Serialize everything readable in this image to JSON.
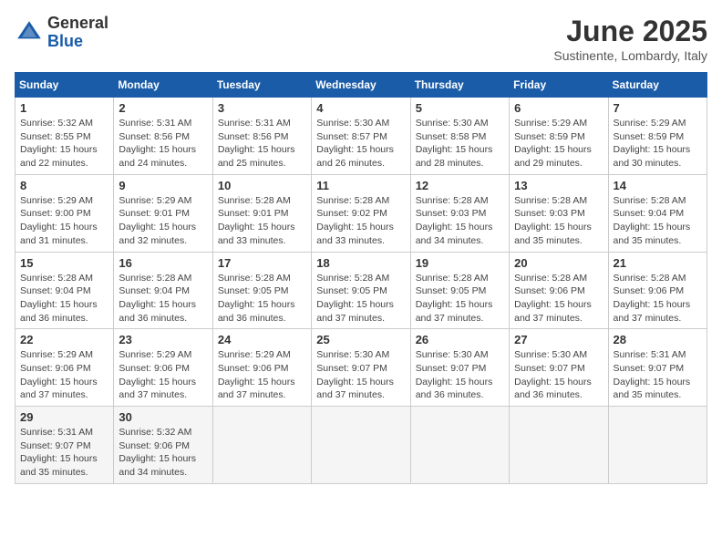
{
  "logo": {
    "general": "General",
    "blue": "Blue"
  },
  "header": {
    "month": "June 2025",
    "location": "Sustinente, Lombardy, Italy"
  },
  "weekdays": [
    "Sunday",
    "Monday",
    "Tuesday",
    "Wednesday",
    "Thursday",
    "Friday",
    "Saturday"
  ],
  "weeks": [
    [
      {
        "day": "1",
        "sunrise": "5:32 AM",
        "sunset": "8:55 PM",
        "daylight": "15 hours and 22 minutes."
      },
      {
        "day": "2",
        "sunrise": "5:31 AM",
        "sunset": "8:56 PM",
        "daylight": "15 hours and 24 minutes."
      },
      {
        "day": "3",
        "sunrise": "5:31 AM",
        "sunset": "8:56 PM",
        "daylight": "15 hours and 25 minutes."
      },
      {
        "day": "4",
        "sunrise": "5:30 AM",
        "sunset": "8:57 PM",
        "daylight": "15 hours and 26 minutes."
      },
      {
        "day": "5",
        "sunrise": "5:30 AM",
        "sunset": "8:58 PM",
        "daylight": "15 hours and 28 minutes."
      },
      {
        "day": "6",
        "sunrise": "5:29 AM",
        "sunset": "8:59 PM",
        "daylight": "15 hours and 29 minutes."
      },
      {
        "day": "7",
        "sunrise": "5:29 AM",
        "sunset": "8:59 PM",
        "daylight": "15 hours and 30 minutes."
      }
    ],
    [
      {
        "day": "8",
        "sunrise": "5:29 AM",
        "sunset": "9:00 PM",
        "daylight": "15 hours and 31 minutes."
      },
      {
        "day": "9",
        "sunrise": "5:29 AM",
        "sunset": "9:01 PM",
        "daylight": "15 hours and 32 minutes."
      },
      {
        "day": "10",
        "sunrise": "5:28 AM",
        "sunset": "9:01 PM",
        "daylight": "15 hours and 33 minutes."
      },
      {
        "day": "11",
        "sunrise": "5:28 AM",
        "sunset": "9:02 PM",
        "daylight": "15 hours and 33 minutes."
      },
      {
        "day": "12",
        "sunrise": "5:28 AM",
        "sunset": "9:03 PM",
        "daylight": "15 hours and 34 minutes."
      },
      {
        "day": "13",
        "sunrise": "5:28 AM",
        "sunset": "9:03 PM",
        "daylight": "15 hours and 35 minutes."
      },
      {
        "day": "14",
        "sunrise": "5:28 AM",
        "sunset": "9:04 PM",
        "daylight": "15 hours and 35 minutes."
      }
    ],
    [
      {
        "day": "15",
        "sunrise": "5:28 AM",
        "sunset": "9:04 PM",
        "daylight": "15 hours and 36 minutes."
      },
      {
        "day": "16",
        "sunrise": "5:28 AM",
        "sunset": "9:04 PM",
        "daylight": "15 hours and 36 minutes."
      },
      {
        "day": "17",
        "sunrise": "5:28 AM",
        "sunset": "9:05 PM",
        "daylight": "15 hours and 36 minutes."
      },
      {
        "day": "18",
        "sunrise": "5:28 AM",
        "sunset": "9:05 PM",
        "daylight": "15 hours and 37 minutes."
      },
      {
        "day": "19",
        "sunrise": "5:28 AM",
        "sunset": "9:05 PM",
        "daylight": "15 hours and 37 minutes."
      },
      {
        "day": "20",
        "sunrise": "5:28 AM",
        "sunset": "9:06 PM",
        "daylight": "15 hours and 37 minutes."
      },
      {
        "day": "21",
        "sunrise": "5:28 AM",
        "sunset": "9:06 PM",
        "daylight": "15 hours and 37 minutes."
      }
    ],
    [
      {
        "day": "22",
        "sunrise": "5:29 AM",
        "sunset": "9:06 PM",
        "daylight": "15 hours and 37 minutes."
      },
      {
        "day": "23",
        "sunrise": "5:29 AM",
        "sunset": "9:06 PM",
        "daylight": "15 hours and 37 minutes."
      },
      {
        "day": "24",
        "sunrise": "5:29 AM",
        "sunset": "9:06 PM",
        "daylight": "15 hours and 37 minutes."
      },
      {
        "day": "25",
        "sunrise": "5:30 AM",
        "sunset": "9:07 PM",
        "daylight": "15 hours and 37 minutes."
      },
      {
        "day": "26",
        "sunrise": "5:30 AM",
        "sunset": "9:07 PM",
        "daylight": "15 hours and 36 minutes."
      },
      {
        "day": "27",
        "sunrise": "5:30 AM",
        "sunset": "9:07 PM",
        "daylight": "15 hours and 36 minutes."
      },
      {
        "day": "28",
        "sunrise": "5:31 AM",
        "sunset": "9:07 PM",
        "daylight": "15 hours and 35 minutes."
      }
    ],
    [
      {
        "day": "29",
        "sunrise": "5:31 AM",
        "sunset": "9:07 PM",
        "daylight": "15 hours and 35 minutes."
      },
      {
        "day": "30",
        "sunrise": "5:32 AM",
        "sunset": "9:06 PM",
        "daylight": "15 hours and 34 minutes."
      },
      null,
      null,
      null,
      null,
      null
    ]
  ]
}
